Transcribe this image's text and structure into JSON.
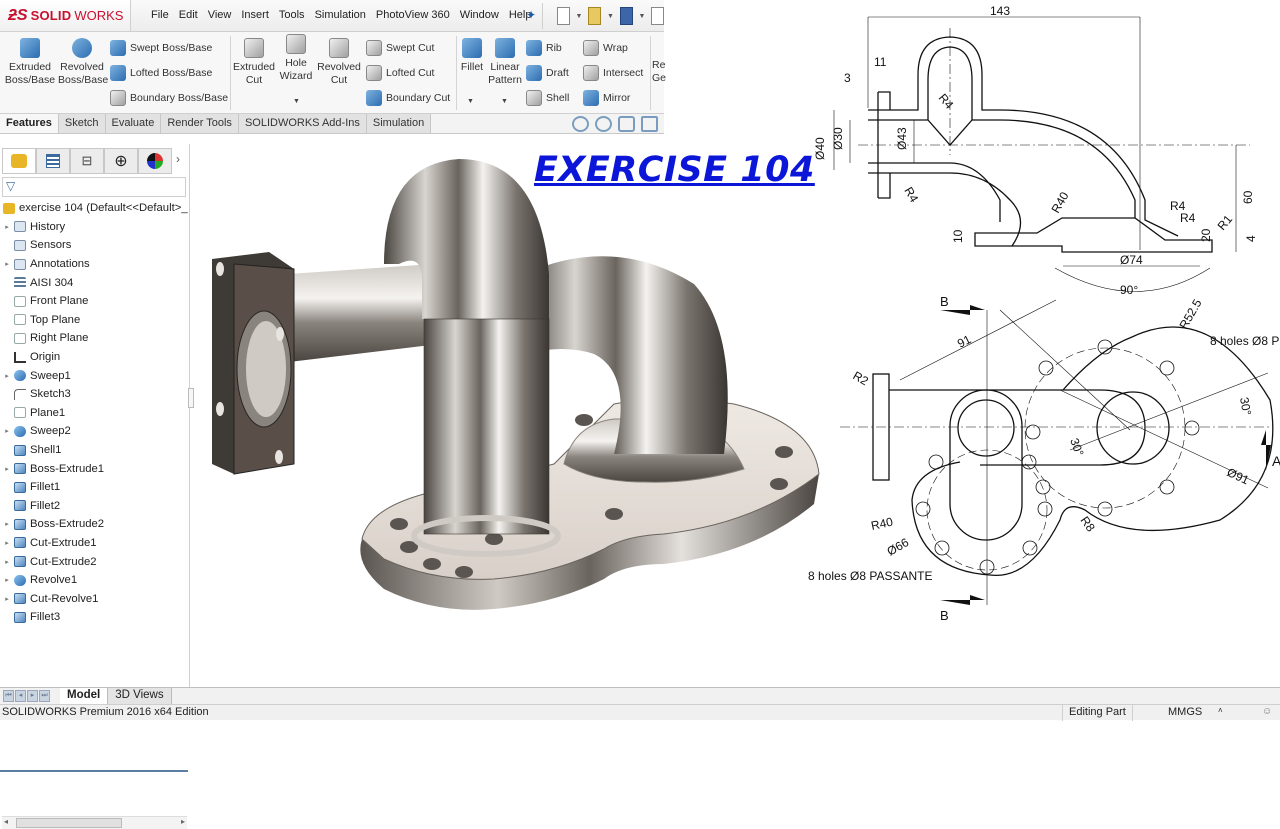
{
  "app": {
    "logo_ds": "ƻS",
    "logo_solid": "SOLID",
    "logo_works": "WORKS",
    "menu": [
      "File",
      "Edit",
      "View",
      "Insert",
      "Tools",
      "Simulation",
      "PhotoView 360",
      "Window",
      "Help"
    ],
    "pin_icon": "pin-icon",
    "quick_access": [
      "new-document-icon",
      "open-icon",
      "save-icon",
      "print-icon"
    ]
  },
  "ribbon": {
    "large_buttons": [
      {
        "label1": "Extruded",
        "label2": "Boss/Base",
        "icon": "extruded-boss-icon"
      },
      {
        "label1": "Revolved",
        "label2": "Boss/Base",
        "icon": "revolved-boss-icon"
      },
      {
        "label1": "Extruded",
        "label2": "Cut",
        "icon": "extruded-cut-icon"
      },
      {
        "label1": "Hole",
        "label2": "Wizard",
        "icon": "hole-wizard-icon"
      },
      {
        "label1": "Revolved",
        "label2": "Cut",
        "icon": "revolved-cut-icon"
      },
      {
        "label1": "Fillet",
        "label2": "",
        "icon": "fillet-icon"
      },
      {
        "label1": "Linear",
        "label2": "Pattern",
        "icon": "linear-pattern-icon"
      },
      {
        "label1": "Re",
        "label2": "Ge",
        "icon": "reference-geometry-icon"
      }
    ],
    "small_buttons": [
      {
        "label": "Swept Boss/Base",
        "icon": "swept-boss-icon"
      },
      {
        "label": "Lofted Boss/Base",
        "icon": "lofted-boss-icon"
      },
      {
        "label": "Boundary Boss/Base",
        "icon": "boundary-boss-icon"
      },
      {
        "label": "Swept Cut",
        "icon": "swept-cut-icon"
      },
      {
        "label": "Lofted Cut",
        "icon": "lofted-cut-icon"
      },
      {
        "label": "Boundary Cut",
        "icon": "boundary-cut-icon"
      },
      {
        "label": "Rib",
        "icon": "rib-icon"
      },
      {
        "label": "Draft",
        "icon": "draft-icon"
      },
      {
        "label": "Shell",
        "icon": "shell-icon"
      },
      {
        "label": "Wrap",
        "icon": "wrap-icon"
      },
      {
        "label": "Intersect",
        "icon": "intersect-icon"
      },
      {
        "label": "Mirror",
        "icon": "mirror-icon"
      }
    ],
    "tabs": [
      {
        "label": "Features",
        "active": true
      },
      {
        "label": "Sketch",
        "active": false
      },
      {
        "label": "Evaluate",
        "active": false
      },
      {
        "label": "Render Tools",
        "active": false
      },
      {
        "label": "SOLIDWORKS Add-Ins",
        "active": false
      },
      {
        "label": "Simulation",
        "active": false
      }
    ]
  },
  "feature_manager": {
    "tabs": [
      "feature-tree-icon",
      "property-manager-icon",
      "configuration-manager-icon",
      "dimxpert-icon",
      "display-manager-icon"
    ],
    "more": "›",
    "filter_icon": "▽",
    "root": "exercise 104  (Default<<Default>_",
    "nodes": [
      {
        "label": "History",
        "expandable": true,
        "kind": "folder"
      },
      {
        "label": "Sensors",
        "expandable": false,
        "kind": "folder"
      },
      {
        "label": "Annotations",
        "expandable": true,
        "kind": "folder"
      },
      {
        "label": "AISI 304",
        "expandable": false,
        "kind": "mat"
      },
      {
        "label": "Front Plane",
        "expandable": false,
        "kind": "plane"
      },
      {
        "label": "Top Plane",
        "expandable": false,
        "kind": "plane"
      },
      {
        "label": "Right Plane",
        "expandable": false,
        "kind": "plane"
      },
      {
        "label": "Origin",
        "expandable": false,
        "kind": "origin"
      },
      {
        "label": "Sweep1",
        "expandable": true,
        "kind": "sweep"
      },
      {
        "label": "Sketch3",
        "expandable": false,
        "kind": "sketch"
      },
      {
        "label": "Plane1",
        "expandable": false,
        "kind": "plane"
      },
      {
        "label": "Sweep2",
        "expandable": true,
        "kind": "sweep"
      },
      {
        "label": "Shell1",
        "expandable": false,
        "kind": "feat"
      },
      {
        "label": "Boss-Extrude1",
        "expandable": true,
        "kind": "feat"
      },
      {
        "label": "Fillet1",
        "expandable": false,
        "kind": "feat"
      },
      {
        "label": "Fillet2",
        "expandable": false,
        "kind": "feat"
      },
      {
        "label": "Boss-Extrude2",
        "expandable": true,
        "kind": "feat"
      },
      {
        "label": "Cut-Extrude1",
        "expandable": true,
        "kind": "feat"
      },
      {
        "label": "Cut-Extrude2",
        "expandable": true,
        "kind": "feat"
      },
      {
        "label": "Revolve1",
        "expandable": true,
        "kind": "sweep"
      },
      {
        "label": "Cut-Revolve1",
        "expandable": true,
        "kind": "feat"
      },
      {
        "label": "Fillet3",
        "expandable": false,
        "kind": "feat"
      }
    ]
  },
  "bottom_tabs": [
    {
      "label": "Model",
      "active": true
    },
    {
      "label": "3D Views",
      "active": false
    }
  ],
  "status": {
    "edition": "SOLIDWORKS Premium 2016 x64 Edition",
    "editing": "Editing Part",
    "units": "MMGS",
    "caret": "˄"
  },
  "overlay": {
    "title": "EXERCISE 104",
    "title_color": "#0b16d8"
  },
  "drawing": {
    "section_view_dims": [
      "143",
      "11",
      "3",
      "Ø40",
      "Ø30",
      "Ø43",
      "R4",
      "R4",
      "R40",
      "R4",
      "R4",
      "R1",
      "4",
      "60",
      "20",
      "10",
      "Ø74",
      "90°"
    ],
    "top_view_dims": [
      "B",
      "B",
      "91",
      "R2",
      "R52.5",
      "8 holes Ø8 P",
      "30°",
      "30°",
      "A",
      "Ø91",
      "R8",
      "R40",
      "Ø66",
      "8 holes Ø8 PASSANTE"
    ]
  }
}
